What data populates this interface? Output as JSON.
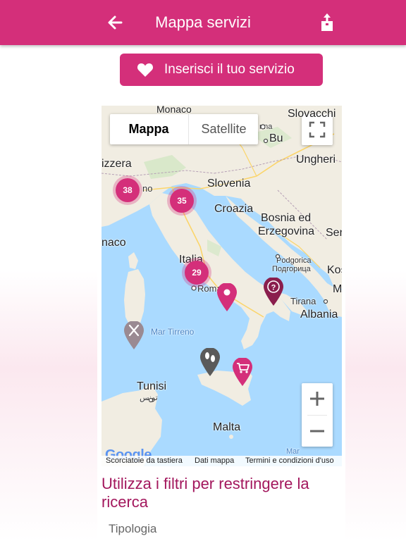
{
  "header": {
    "title": "Mappa servizi",
    "back_icon": "arrow-left-icon",
    "share_icon": "share-icon",
    "color": "#d42f7a"
  },
  "cta": {
    "label": "Inserisci il tuo servizio",
    "icon": "heart-icon"
  },
  "map": {
    "map_type": {
      "active": "Mappa",
      "inactive": "Satellite"
    },
    "labels": {
      "monaco_top": "Monaco",
      "slovacchia": "Slovacchi",
      "vienna": "nna",
      "budapest": "Bu",
      "ungheria": "Ungheri",
      "svizzera": "izzera",
      "milano": "no",
      "slovenia": "Slovenia",
      "croazia": "Croazia",
      "bosnia": "Bosnia ed",
      "erzegovina": "Erzegovina",
      "serbia": "Ser",
      "monaco_left": "naco",
      "italia": "Italia",
      "roma": "Roma",
      "podgorica": "Podgorica",
      "podgorica_cyr": "Подгорица",
      "kosovo": "Kos",
      "mac": "M",
      "tirana": "Tirana",
      "albania": "Albania",
      "mar_tirreno": "Mar Tirreno",
      "tunisi": "Tunisi",
      "tunisi_ar": "تونس",
      "malta": "Malta",
      "mar": "Mar",
      "google": "Google"
    },
    "clusters": [
      "38",
      "35",
      "29"
    ],
    "pins": [
      {
        "name": "location-pin-icon",
        "color": "#d42f7a"
      },
      {
        "name": "question-pin-icon",
        "color": "#8a1e4d"
      },
      {
        "name": "tools-pin-icon",
        "color": "#9a8a92"
      },
      {
        "name": "footprints-pin-icon",
        "color": "#5a5a5a"
      },
      {
        "name": "cart-pin-icon",
        "color": "#d42f7a"
      }
    ],
    "attribution": {
      "shortcuts": "Scorciatoie da tastiera",
      "data": "Dati mappa",
      "terms": "Termini e condizioni d'uso"
    },
    "zoom_in_icon": "plus-icon",
    "zoom_out_icon": "minus-icon",
    "fullscreen_icon": "fullscreen-icon"
  },
  "filters": {
    "title": "Utilizza i filtri per restringere la ricerca",
    "subheading": "Tipologia"
  }
}
